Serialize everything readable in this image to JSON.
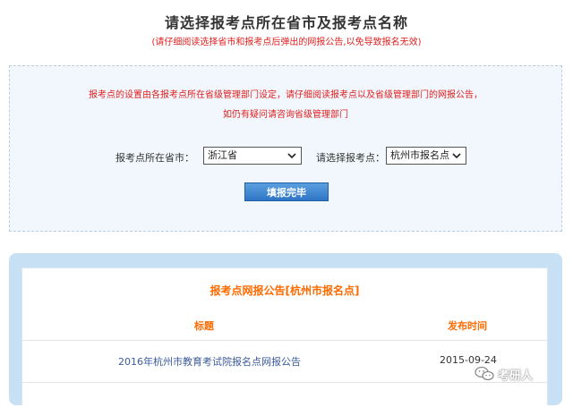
{
  "header": {
    "title": "请选择报考点所在省市及报考点名称",
    "subtitle": "(请仔细阅读选择省市和报考点后弹出的网报公告,以免导致报名无效)"
  },
  "select_panel": {
    "notice_line1": "报考点的设置由各报考点所在省级管理部门设定，请仔细阅读报考点以及省级管理部门的网报公告，",
    "notice_line2": "如仍有疑问请咨询省级管理部门",
    "province_label": "报考点所在省市：",
    "province_value": "浙江省",
    "site_label": "请选择报考点：",
    "site_value": "杭州市报名点",
    "submit_label": "填报完毕"
  },
  "announcement": {
    "title": "报考点网报公告[杭州市报名点]",
    "columns": [
      "标题",
      "发布时间"
    ],
    "rows": [
      {
        "title": "2016年杭州市教育考试院报名点网报公告",
        "date": "2015-09-24"
      }
    ]
  },
  "watermark": {
    "text": "考研人",
    "icon": "wechat-icon"
  },
  "colors": {
    "accent_red": "#e02020",
    "accent_orange": "#ff6a00",
    "button_blue": "#2f75c6",
    "panel_blue": "#c8e0f3"
  }
}
